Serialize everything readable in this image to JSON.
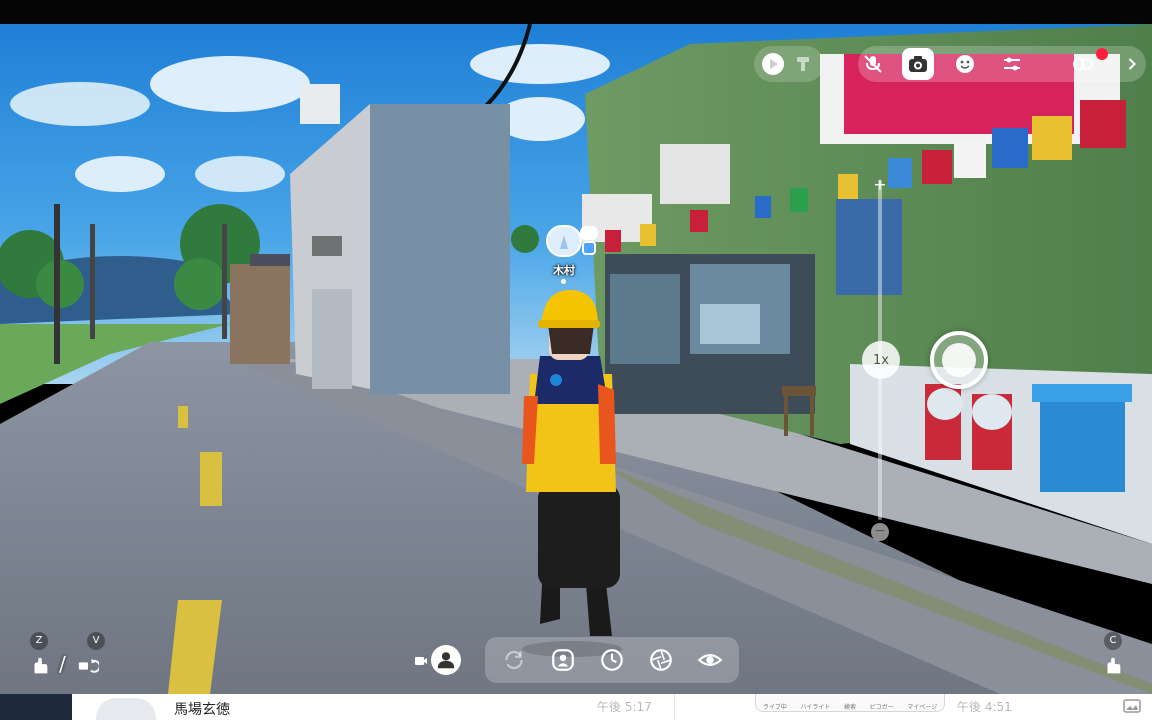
{
  "scene": {
    "character_nameplate": {
      "name": "木村"
    }
  },
  "toolbar": {
    "icons": [
      "play-icon",
      "brush-icon",
      "mic-off-icon",
      "camera-icon",
      "face-icon",
      "sliders-icon",
      "record-icon",
      "chevron-right-icon"
    ]
  },
  "zoom": {
    "level_label": "1x"
  },
  "controls": {
    "left_key_1": "Z",
    "left_key_2": "V",
    "right_key": "C",
    "separator": "/"
  },
  "bottom_app": {
    "sender_name": "馬場玄徳",
    "time_1": "午後 5:17",
    "time_2": "午後 4:51",
    "thumb_tabs": [
      "ライブ中",
      "ハイライト",
      "検索",
      "ピコガー",
      "マイページ"
    ]
  },
  "colors": {
    "accent_red": "#ff1e3c",
    "jacket_yellow": "#f2c418",
    "helmet_yellow": "#f5c400",
    "sky_blue": "#2a8de0"
  }
}
